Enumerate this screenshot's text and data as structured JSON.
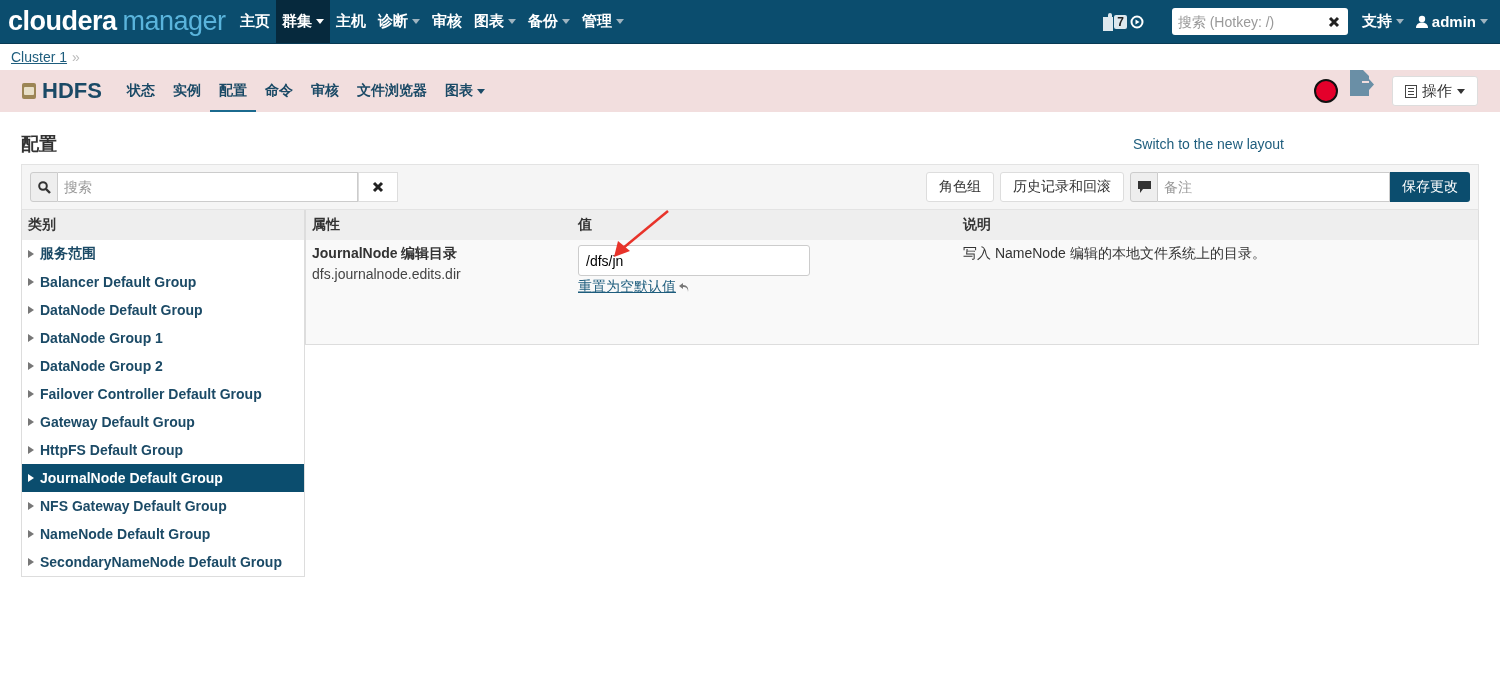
{
  "topbar": {
    "logo_main": "cloudera",
    "logo_sub": "manager",
    "menu": [
      {
        "label": "主页",
        "dropdown": false,
        "selected": false
      },
      {
        "label": "群集",
        "dropdown": true,
        "selected": true
      },
      {
        "label": "主机",
        "dropdown": false,
        "selected": false
      },
      {
        "label": "诊断",
        "dropdown": true,
        "selected": false
      },
      {
        "label": "审核",
        "dropdown": false,
        "selected": false
      },
      {
        "label": "图表",
        "dropdown": true,
        "selected": false
      },
      {
        "label": "备份",
        "dropdown": true,
        "selected": false
      },
      {
        "label": "管理",
        "dropdown": true,
        "selected": false
      }
    ],
    "badge": "7",
    "search": {
      "placeholder": "搜索 (Hotkey: /)"
    },
    "support": "支持",
    "user": "admin"
  },
  "breadcrumb": {
    "link": "Cluster 1",
    "separator": "»"
  },
  "service": {
    "name": "HDFS",
    "tabs": [
      {
        "label": "状态",
        "selected": false,
        "dropdown": false
      },
      {
        "label": "实例",
        "selected": false,
        "dropdown": false
      },
      {
        "label": "配置",
        "selected": true,
        "dropdown": false
      },
      {
        "label": "命令",
        "selected": false,
        "dropdown": false
      },
      {
        "label": "审核",
        "selected": false,
        "dropdown": false
      },
      {
        "label": "文件浏览器",
        "selected": false,
        "dropdown": false
      },
      {
        "label": "图表",
        "selected": false,
        "dropdown": true
      }
    ],
    "healthy": false,
    "actions": "操作"
  },
  "page": {
    "title": "配置",
    "switch_link": "Switch to the new layout"
  },
  "toolbar": {
    "search": {
      "placeholder": "搜索"
    },
    "role_groups": "角色组",
    "history": "历史记录和回滚",
    "note": {
      "placeholder": "备注"
    },
    "save": "保存更改"
  },
  "categories": {
    "heading": "类别",
    "items": [
      {
        "label": "服务范围",
        "selected": false
      },
      {
        "label": "Balancer Default Group",
        "selected": false
      },
      {
        "label": "DataNode Default Group",
        "selected": false
      },
      {
        "label": "DataNode Group 1",
        "selected": false
      },
      {
        "label": "DataNode Group 2",
        "selected": false
      },
      {
        "label": "Failover Controller Default Group",
        "selected": false
      },
      {
        "label": "Gateway Default Group",
        "selected": false
      },
      {
        "label": "HttpFS Default Group",
        "selected": false
      },
      {
        "label": "JournalNode Default Group",
        "selected": true
      },
      {
        "label": "NFS Gateway Default Group",
        "selected": false
      },
      {
        "label": "NameNode Default Group",
        "selected": false
      },
      {
        "label": "SecondaryNameNode Default Group",
        "selected": false
      }
    ]
  },
  "table": {
    "columns": [
      "属性",
      "值",
      "说明"
    ],
    "rows": [
      {
        "name": "JournalNode 编辑目录",
        "key": "dfs.journalnode.edits.dir",
        "value": "/dfs/jn",
        "reset": "重置为空默认值",
        "description": "写入 NameNode 编辑的本地文件系统上的目录。"
      }
    ]
  }
}
